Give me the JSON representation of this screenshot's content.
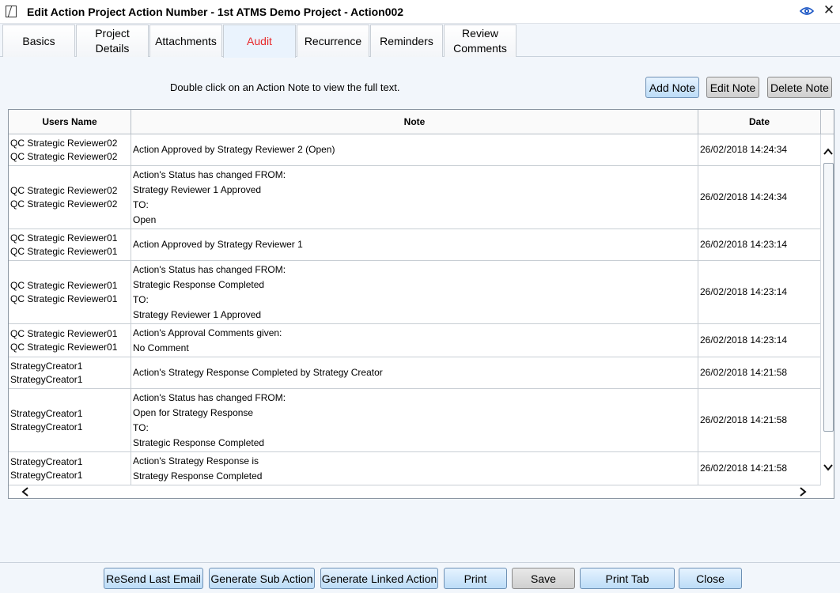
{
  "window": {
    "title": "Edit Action Project Action Number - 1st ATMS Demo Project - Action002",
    "close_glyph": "✕"
  },
  "tabs": [
    {
      "label": "Basics"
    },
    {
      "label": "Project\nDetails"
    },
    {
      "label": "Attachments"
    },
    {
      "label": "Audit",
      "active": true
    },
    {
      "label": "Recurrence"
    },
    {
      "label": "Reminders"
    },
    {
      "label": "Review\nComments"
    }
  ],
  "hint": "Double click on an Action Note to view the full text.",
  "note_buttons": {
    "add": "Add Note",
    "edit": "Edit Note",
    "delete": "Delete Note"
  },
  "table": {
    "headers": {
      "user": "Users Name",
      "note": "Note",
      "date": "Date"
    },
    "rows": [
      {
        "user": [
          "QC Strategic Reviewer02",
          "QC Strategic Reviewer02"
        ],
        "note": [
          "Action Approved by Strategy Reviewer 2 (Open)"
        ],
        "date": "26/02/2018 14:24:34"
      },
      {
        "user": [
          "QC Strategic Reviewer02",
          "QC Strategic Reviewer02"
        ],
        "note": [
          "Action's Status has changed FROM:",
          "Strategy Reviewer 1 Approved",
          "TO:",
          "Open"
        ],
        "date": "26/02/2018 14:24:34"
      },
      {
        "user": [
          "QC Strategic Reviewer01",
          "QC Strategic Reviewer01"
        ],
        "note": [
          "Action Approved by Strategy Reviewer 1"
        ],
        "date": "26/02/2018 14:23:14"
      },
      {
        "user": [
          "QC Strategic Reviewer01",
          "QC Strategic Reviewer01"
        ],
        "note": [
          "Action's Status has changed FROM:",
          "Strategic Response Completed",
          "TO:",
          "Strategy Reviewer 1 Approved"
        ],
        "date": "26/02/2018 14:23:14"
      },
      {
        "user": [
          "QC Strategic Reviewer01",
          "QC Strategic Reviewer01"
        ],
        "note": [
          "Action's Approval Comments given:",
          "No Comment"
        ],
        "date": "26/02/2018 14:23:14"
      },
      {
        "user": [
          "StrategyCreator1",
          "StrategyCreator1"
        ],
        "note": [
          "Action's Strategy Response Completed by Strategy Creator"
        ],
        "date": "26/02/2018 14:21:58"
      },
      {
        "user": [
          "StrategyCreator1",
          "StrategyCreator1"
        ],
        "note": [
          "Action's Status has changed FROM:",
          "Open for Strategy Response",
          "TO:",
          "Strategic Response Completed"
        ],
        "date": "26/02/2018 14:21:58"
      },
      {
        "user": [
          "StrategyCreator1",
          "StrategyCreator1"
        ],
        "note": [
          "Action's Strategy Response is",
          "Strategy Response Completed"
        ],
        "date": "26/02/2018 14:21:58"
      }
    ]
  },
  "footer_buttons": {
    "resend": "ReSend Last Email",
    "sub_action": "Generate Sub Action",
    "linked_action": "Generate Linked Action",
    "print": "Print",
    "save": "Save",
    "print_tab": "Print Tab",
    "close": "Close"
  },
  "colors": {
    "active_tab_text": "#e8282b",
    "accent_blue": "#bcdcf7",
    "background": "#f2f6fb"
  }
}
